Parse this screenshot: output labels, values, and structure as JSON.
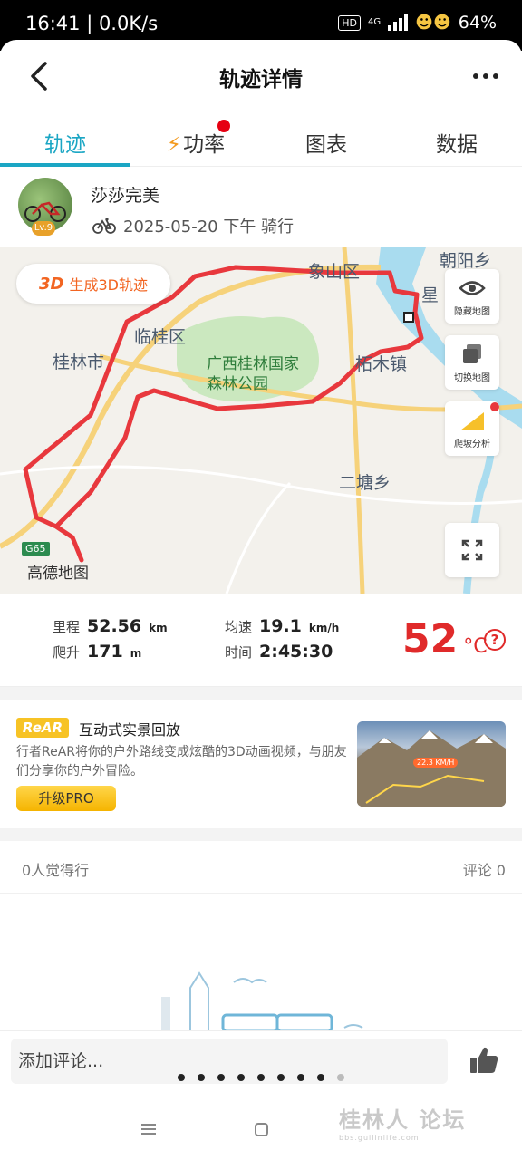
{
  "status_bar": {
    "time": "16:41 | 0.0K/s",
    "hd": "HD",
    "network": "4G",
    "battery": "64%"
  },
  "header": {
    "title": "轨迹详情"
  },
  "tabs": [
    {
      "label": "轨迹",
      "active": true
    },
    {
      "label": "功率",
      "badge": true
    },
    {
      "label": "图表"
    },
    {
      "label": "数据"
    }
  ],
  "user": {
    "name": "莎莎完美",
    "level": "Lv.9",
    "date_line": "2025-05-20 下午 骑行"
  },
  "map": {
    "btn_3d_prefix": "3D",
    "btn_3d_label": "生成3D轨迹",
    "labels": {
      "xiangshan": "象山区",
      "chaoyang": "朝阳乡",
      "lingui": "临桂区",
      "guilin": "桂林市",
      "forest": "广西桂林国家森林公园",
      "qixing": "星",
      "limu": "柘木镇",
      "ertang": "二塘乡",
      "highway": "G65",
      "logo": "高德地图"
    },
    "tools": [
      {
        "label": "隐藏地图",
        "icon": "eye-icon"
      },
      {
        "label": "切换地图",
        "icon": "layers-icon"
      },
      {
        "label": "爬坡分析",
        "icon": "slope-icon"
      }
    ],
    "colors": {
      "route": "#e8383d",
      "park": "#cbe8bf",
      "water": "#a9dcef",
      "road": "#f6d27a"
    }
  },
  "stats": {
    "distance_label": "里程",
    "distance_value": "52.56",
    "distance_unit": "km",
    "climb_label": "爬升",
    "climb_value": "171",
    "climb_unit": "m",
    "speed_label": "均速",
    "speed_value": "19.1",
    "speed_unit": "km/h",
    "time_label": "时间",
    "time_value": "2:45:30",
    "temp_value": "52",
    "temp_unit": "°C"
  },
  "promo": {
    "logo": "ReAR",
    "title": "互动式实景回放",
    "description": "行者ReAR将你的户外路线变成炫酷的3D动画视频，与朋友们分享你的户外冒险。",
    "button": "升级PRO",
    "image_speed": "22.3 KM/H"
  },
  "social": {
    "likes": "0人觉得行",
    "comments": "评论 0"
  },
  "comment_bar": {
    "placeholder": "添加评论..."
  },
  "watermark": {
    "main": "桂林人 论坛",
    "sub": "bbs.guilinlife.com"
  }
}
